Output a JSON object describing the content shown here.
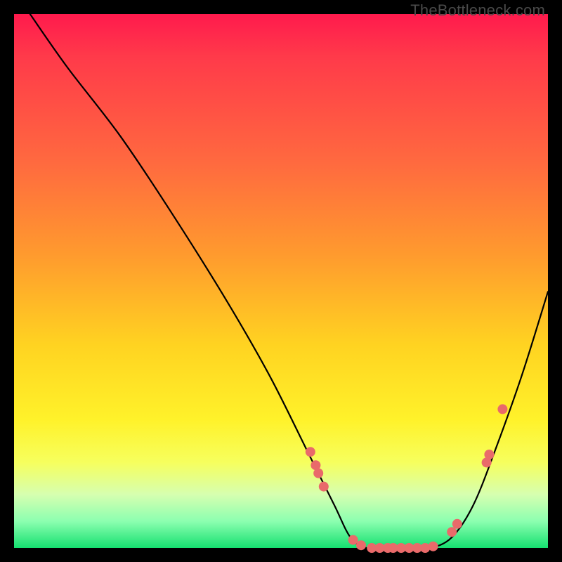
{
  "watermark": "TheBottleneck.com",
  "colors": {
    "dot": "#e96a6a",
    "curve": "#000000",
    "bg_black": "#000000"
  },
  "chart_data": {
    "type": "line",
    "title": "",
    "xlabel": "",
    "ylabel": "",
    "xlim": [
      0,
      100
    ],
    "ylim": [
      0,
      100
    ],
    "note": "No numeric axis ticks or labels are visible; x/y are normalized 0–100 percent of plot area. The curve is a bottleneck-style V with a flat bottom; y≈0 along the flat segment.",
    "series": [
      {
        "name": "bottleneck-curve",
        "x": [
          3,
          10,
          20,
          30,
          40,
          48,
          55,
          60,
          63,
          66,
          70,
          74,
          78,
          82,
          86,
          90,
          95,
          100
        ],
        "y": [
          100,
          90,
          77,
          62,
          46,
          32,
          18,
          8,
          2,
          0,
          0,
          0,
          0,
          2,
          8,
          18,
          32,
          48
        ]
      }
    ],
    "dots": {
      "name": "highlighted-points",
      "x": [
        55.5,
        56.5,
        57.0,
        58.0,
        63.5,
        65.0,
        67.0,
        68.5,
        70.0,
        71.0,
        72.5,
        74.0,
        75.5,
        77.0,
        78.5,
        82.0,
        83.0,
        88.5,
        89.0,
        91.5
      ],
      "y": [
        18.0,
        15.5,
        14.0,
        11.5,
        1.5,
        0.5,
        0.0,
        0.0,
        0.0,
        0.0,
        0.0,
        0.0,
        0.0,
        0.0,
        0.3,
        3.0,
        4.5,
        16.0,
        17.5,
        26.0
      ]
    }
  }
}
